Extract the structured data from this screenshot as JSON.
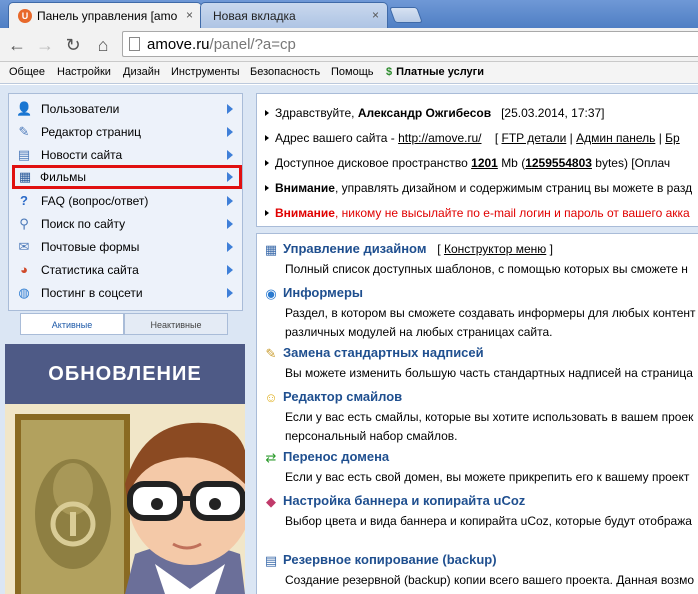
{
  "browser": {
    "tabs": [
      {
        "title": "Панель управления [amo",
        "active": true
      },
      {
        "title": "Новая вкладка",
        "active": false
      }
    ],
    "close_glyph": "×",
    "back_glyph": "←",
    "forward_glyph": "→",
    "reload_glyph": "↻",
    "home_glyph": "⌂",
    "url_host": "amove.ru",
    "url_path": "/panel/?a=cp"
  },
  "top_menu": {
    "items": [
      "Общее",
      "Настройки",
      "Дизайн",
      "Инструменты",
      "Безопасность",
      "Помощь"
    ],
    "paid_glyph": "$",
    "paid_label": "Платные услуги"
  },
  "sidebar": {
    "items": [
      {
        "label": "Пользователи",
        "icon": "user-icon",
        "glyph": "👤"
      },
      {
        "label": "Редактор страниц",
        "icon": "page-edit-icon",
        "glyph": "✎"
      },
      {
        "label": "Новости сайта",
        "icon": "news-icon",
        "glyph": "▤"
      },
      {
        "label": "Фильмы",
        "icon": "film-icon",
        "glyph": "▦",
        "selected": true
      },
      {
        "label": "FAQ (вопрос/ответ)",
        "icon": "help-icon",
        "glyph": "?"
      },
      {
        "label": "Поиск по сайту",
        "icon": "search-icon",
        "glyph": "⚲"
      },
      {
        "label": "Почтовые формы",
        "icon": "mail-icon",
        "glyph": "✉"
      },
      {
        "label": "Статистика сайта",
        "icon": "chart-icon",
        "glyph": "◕"
      },
      {
        "label": "Постинг в соцсети",
        "icon": "globe-icon",
        "glyph": "◍"
      }
    ],
    "tab_active": "Активные",
    "tab_inactive": "Неактивные"
  },
  "banner": {
    "heading": "ОБНОВЛЕНИЕ"
  },
  "info": {
    "greeting": "Здравствуйте,",
    "user_name": "Александр Ожгибесов",
    "datetime": "[25.03.2014, 17:37]",
    "site_address_label": "Адрес вашего сайта -",
    "site_url": "http://amove.ru/",
    "ftp_link": "FTP детали",
    "admin_link": "Админ панель",
    "cut_link": "Бр",
    "disk_label": "Доступное дисковое пространство",
    "disk_mb": "1201",
    "disk_mb_unit": "Mb",
    "disk_bytes": "1259554803",
    "disk_bytes_unit": "bytes) [Оплач",
    "warn1_bold": "Внимание",
    "warn1_text": ", управлять дизайном и содержимым страниц вы можете в разд",
    "warn2_bold": "Внимание",
    "warn2_text": ", никому не высылайте по e-mail логин и пароль от вашего акка"
  },
  "sections": [
    {
      "title": "Управление дизайном",
      "extra_link": "Конструктор меню",
      "icon": "design-icon",
      "glyph": "▦",
      "desc": [
        "Полный список доступных шаблонов, с помощью которых вы сможете н"
      ]
    },
    {
      "title": "Информеры",
      "icon": "informer-icon",
      "glyph": "◉",
      "desc": [
        "Раздел, в котором вы сможете создавать информеры для любых контент",
        "различных модулей на любых страницах сайта."
      ]
    },
    {
      "title": "Замена стандартных надписей",
      "icon": "replace-text-icon",
      "glyph": "✎",
      "desc": [
        "Вы можете изменить большую часть стандартных надписей на страница"
      ]
    },
    {
      "title": "Редактор смайлов",
      "icon": "smiley-icon",
      "glyph": "☺",
      "desc": [
        "Если у вас есть смайлы, которые вы хотите использовать в вашем проек",
        "персональный набор смайлов."
      ]
    },
    {
      "title": "Перенос домена",
      "icon": "domain-transfer-icon",
      "glyph": "⇄",
      "desc": [
        "Если у вас есть свой домен, вы можете прикрепить его к вашему проект"
      ]
    },
    {
      "title": "Настройка баннера и копирайта uCoz",
      "icon": "banner-icon",
      "glyph": "◆",
      "desc": [
        "Выбор цвета и вида баннера и копирайта uCoz, которые будут отобража"
      ]
    },
    {
      "title": "Резервное копирование (backup)",
      "icon": "backup-icon",
      "glyph": "▤",
      "desc": [
        "Создание резервной (backup) копии всего вашего проекта. Данная возмо"
      ]
    }
  ]
}
